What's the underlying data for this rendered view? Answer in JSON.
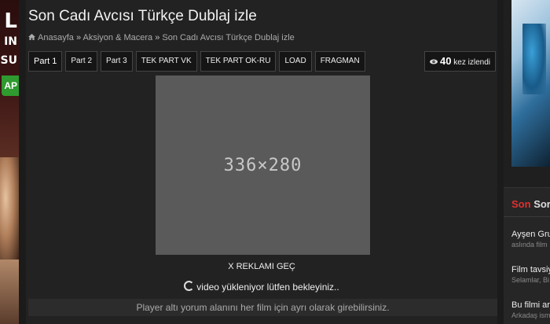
{
  "left_ad": {
    "line1": "L",
    "line2": "IN",
    "line3": "SU",
    "button": "AP"
  },
  "title": "Son Cadı Avcısı Türkçe Dublaj izle",
  "breadcrumb": {
    "home": "Anasayfa",
    "category": "Aksiyon & Macera",
    "current": "Son Cadı Avcısı Türkçe Dublaj izle"
  },
  "tabs": [
    {
      "label": "Part 1"
    },
    {
      "label": "Part 2"
    },
    {
      "label": "Part 3"
    },
    {
      "label": "TEK PART VK"
    },
    {
      "label": "TEK PART OK-RU"
    },
    {
      "label": "LOAD"
    },
    {
      "label": "FRAGMAN"
    }
  ],
  "views": {
    "count": "40",
    "label": "kez izlendi"
  },
  "player": {
    "placeholder": "336×280"
  },
  "skip_ad": "X REKLAMI GEÇ",
  "loading_text": "video yükleniyor lütfen bekleyiniz..",
  "notice": "Player altı yorum alanını her film için ayrı olarak girebilirsiniz.",
  "sidebar": {
    "title_red": "Son",
    "title_rest": "Sor",
    "items": [
      {
        "title": "Ayşen Gru",
        "sub": "aslında film"
      },
      {
        "title": "Film tavsiy",
        "sub": "Selamlar, Bi"
      },
      {
        "title": "Bu filmi ar",
        "sub": "Arkadaş ism"
      }
    ]
  },
  "colors": {
    "accent_red": "#e03030",
    "background": "#222222",
    "player": "#5a5a5a"
  }
}
